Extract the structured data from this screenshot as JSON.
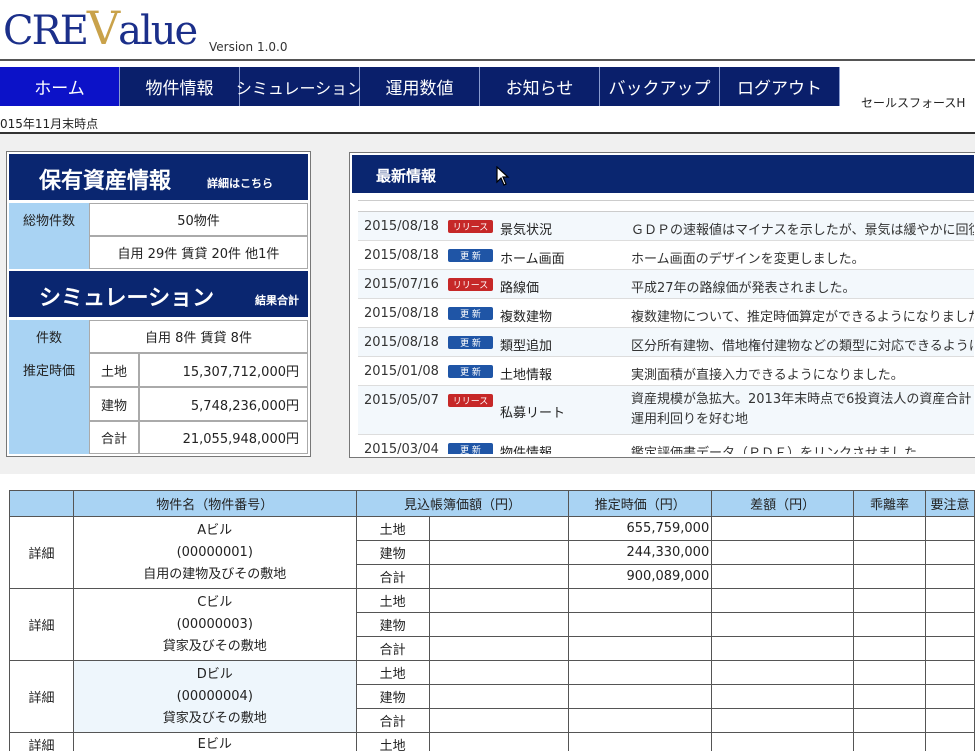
{
  "header": {
    "logo_pre": "CRE",
    "logo_v": "V",
    "logo_post": "alue",
    "version": "Version 1.0.0"
  },
  "nav": {
    "items": [
      "ホーム",
      "物件情報",
      "シミュレーション",
      "運用数値",
      "お知らせ",
      "バックアップ",
      "ログアウト"
    ],
    "active_index": 0,
    "right_text": "セールスフォースH",
    "as_of": "015年11月末時点"
  },
  "asset_panel": {
    "title": "保有資産情報",
    "details_link": "詳細はこちら",
    "total_label": "総物件数",
    "total_value": "50物件",
    "total_breakdown": "自用 29件 賃貸 20件 他1件",
    "sim_title": "シミュレーション",
    "sim_link": "結果合計",
    "count_label": "件数",
    "count_value": "自用 8件 賃貸 8件",
    "estimate_label": "推定時価",
    "estimates": [
      {
        "kind": "土地",
        "value": "15,307,712,000円"
      },
      {
        "kind": "建物",
        "value": "5,748,236,000円"
      },
      {
        "kind": "合計",
        "value": "21,055,948,000円"
      }
    ]
  },
  "news": {
    "title": "最新情報",
    "items": [
      {
        "date": "2015/08/18",
        "badge": "リリース",
        "badge_type": "release",
        "category": "景気状況",
        "text": "ＧＤＰの速報値はマイナスを示したが、景気は緩やかに回復"
      },
      {
        "date": "2015/08/18",
        "badge": "更 新",
        "badge_type": "update",
        "category": "ホーム画面",
        "text": "ホーム画面のデザインを変更しました。"
      },
      {
        "date": "2015/07/16",
        "badge": "リリース",
        "badge_type": "release",
        "category": "路線価",
        "text": "平成27年の路線価が発表されました。"
      },
      {
        "date": "2015/08/18",
        "badge": "更 新",
        "badge_type": "update",
        "category": "複数建物",
        "text": "複数建物について、推定時価算定ができるようになりました"
      },
      {
        "date": "2015/08/18",
        "badge": "更 新",
        "badge_type": "update",
        "category": "類型追加",
        "text": "区分所有建物、借地権付建物などの類型に対応できるように"
      },
      {
        "date": "2015/01/08",
        "badge": "更 新",
        "badge_type": "update",
        "category": "土地情報",
        "text": "実測面積が直接入力できるようになりました。"
      },
      {
        "date": "2015/05/07",
        "badge": "リリース",
        "badge_type": "release",
        "category": "私募リート",
        "text": "資産規模が急拡大。2013年末時点で6投資法人の資産合計\n運用利回りを好む地"
      },
      {
        "date": "2015/03/04",
        "badge": "更 新",
        "badge_type": "update",
        "category": "物件情報",
        "text": "鑑定評価書データ（ＰＤＦ）をリンクさせました"
      }
    ]
  },
  "table": {
    "headers": [
      "",
      "物件名（物件番号）",
      "見込帳簿価額（円）",
      "推定時価（円）",
      "差額（円）",
      "乖離率",
      "要注意"
    ],
    "detail_label": "詳細",
    "kinds": [
      "土地",
      "建物",
      "合計"
    ],
    "rows": [
      {
        "name": "Aビル",
        "number": "(00000001)",
        "type": "自用の建物及びその敷地",
        "estimates": [
          "655,759,000",
          "244,330,000",
          "900,089,000"
        ]
      },
      {
        "name": "Cビル",
        "number": "(00000003)",
        "type": "貸家及びその敷地",
        "estimates": [
          "",
          "",
          ""
        ]
      },
      {
        "name": "Dビル",
        "number": "(00000004)",
        "type": "貸家及びその敷地",
        "estimates": [
          "",
          "",
          ""
        ]
      },
      {
        "name": "Eビル",
        "number": "",
        "type": "",
        "estimates": [
          ""
        ]
      }
    ]
  },
  "colors": {
    "nav_bg": "#0a1f6b",
    "nav_active": "#0c12c8",
    "panel_head": "#0a2670",
    "label_bg": "#a9d3f3",
    "badge_release": "#c62828",
    "badge_update": "#1f55a6"
  }
}
